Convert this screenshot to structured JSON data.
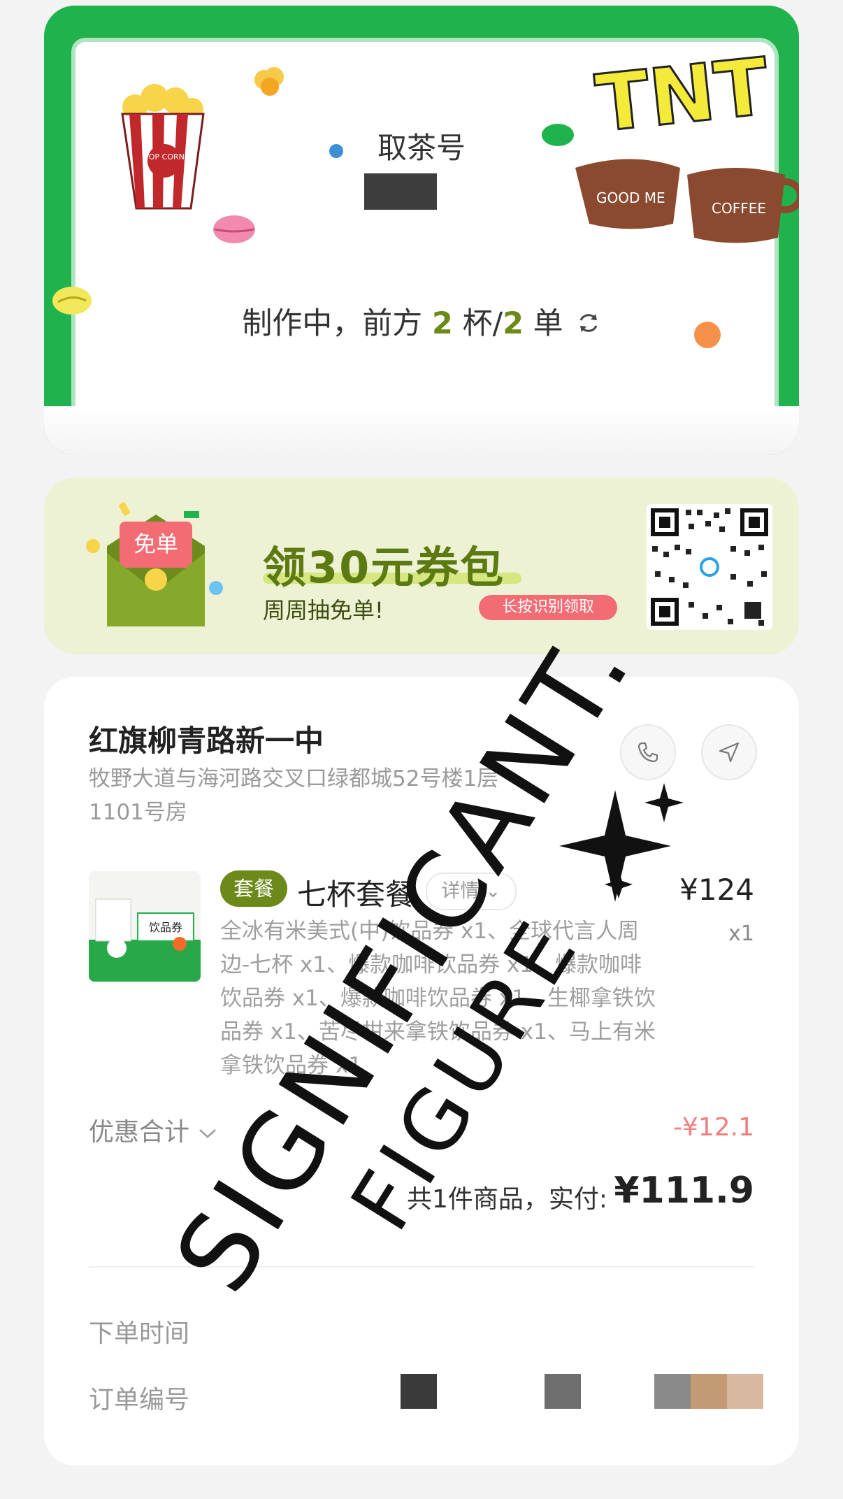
{
  "pickup": {
    "label": "取茶号",
    "status_prefix": "制作中，前方",
    "cups": "2",
    "cups_unit": "杯/",
    "orders": "2",
    "orders_unit": "单",
    "brand_text": "TNT",
    "mug_text_1": "GOOD ME",
    "mug_text_2": "COFFEE",
    "popcorn_text": "POP CORN"
  },
  "coupon": {
    "envelope_text": "免单",
    "title": "领30元券包",
    "subtitle": "周周抽免单!",
    "button": "长按识别领取"
  },
  "order": {
    "store_name": "红旗柳青路新一中",
    "store_address": "牧野大道与海河路交叉口绿都城52号楼1层1101号房",
    "product": {
      "tag": "套餐",
      "name": "七杯套餐",
      "detail": "详情",
      "price": "¥124",
      "qty": "x1",
      "description": "全冰有米美式(中)饮品券 x1、全球代言人周边-七杯 x1、爆款咖啡饮品券 x1、爆款咖啡饮品券 x1、爆款咖啡饮品券 x1、生椰拿铁饮品券 x1、苦尽柑来拿铁饮品券 x1、马上有米拿铁饮品券 x1",
      "image_label": "饮品券"
    },
    "discount_label": "优惠合计",
    "discount_value": "-¥12.1",
    "total_label": "共1件商品，实付:",
    "total_value": "¥111.9",
    "order_time_label": "下单时间",
    "order_no_label": "订单编号"
  },
  "watermark": {
    "line1": "SIGNIFICANT.",
    "line2": "FIGURE"
  },
  "colors": {
    "brand_green": "#6b8a19",
    "frame_green": "#1fb24d",
    "discount_red": "#f08080",
    "coupon_bg": "#eef2d4"
  }
}
